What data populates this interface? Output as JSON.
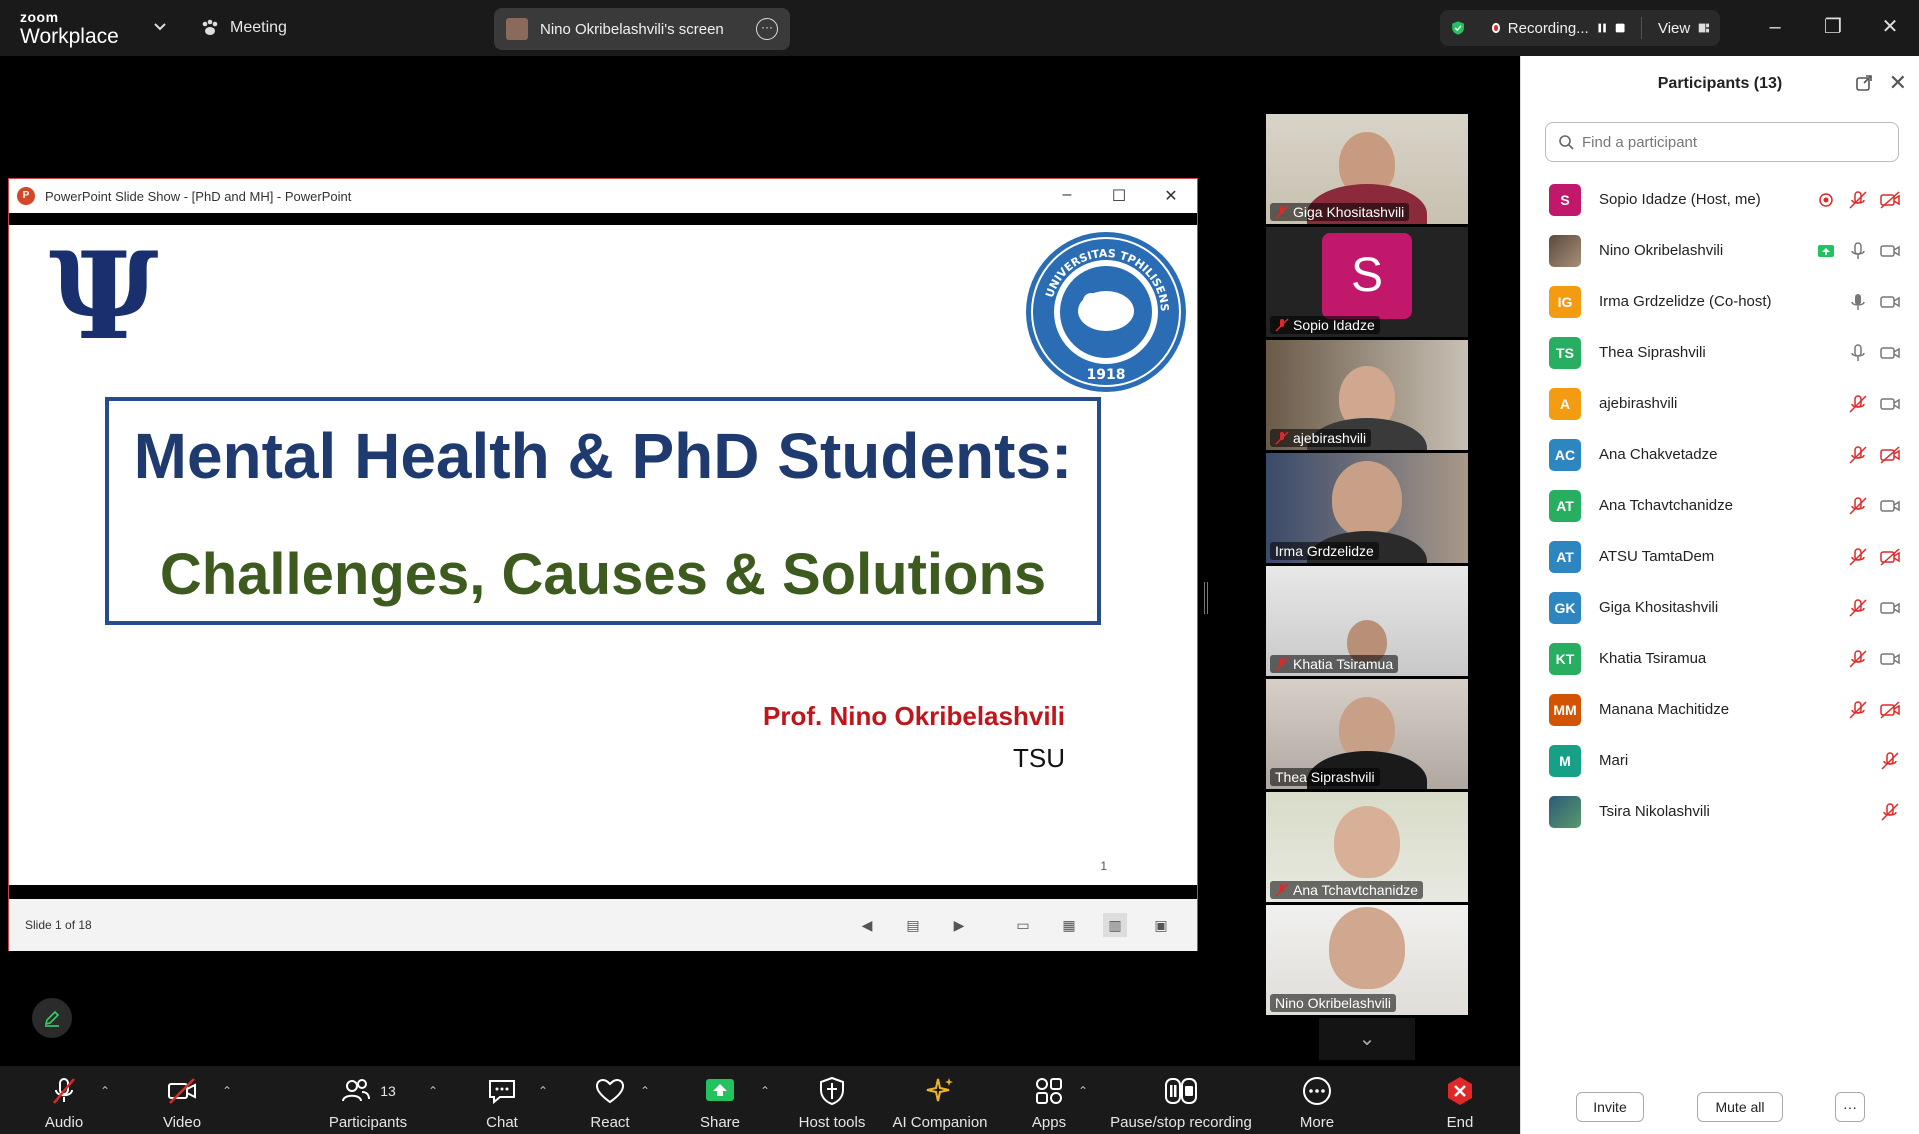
{
  "titlebar": {
    "logo_small": "zoom",
    "logo_big": "Workplace",
    "meeting_label": "Meeting",
    "screen_share_label": "Nino Okribelashvili's screen",
    "recording_label": "Recording...",
    "view_label": "View"
  },
  "ppt": {
    "window_title": "PowerPoint Slide Show - [PhD and MH] - PowerPoint",
    "icon_letter": "P",
    "slide_title_line1": "Mental Health & PhD Students:",
    "slide_title_line2": "Challenges, Causes & Solutions",
    "psi_symbol": "Ψ",
    "author": "Prof. Nino Okribelashvili",
    "institution": "TSU",
    "page_number": "1",
    "seal_year": "1918",
    "seal_text": "UNIVERSITAS TPHILISENSIS",
    "status": "Slide 1 of 18"
  },
  "video_tiles": [
    {
      "name": "Giga Khositashvili",
      "muted": true
    },
    {
      "name": "Sopio Idadze",
      "muted": true,
      "avatar": "S"
    },
    {
      "name": "ajebirashvili",
      "muted": true
    },
    {
      "name": "Irma Grdzelidze",
      "muted": false,
      "active": true
    },
    {
      "name": "Khatia Tsiramua",
      "muted": true
    },
    {
      "name": "Thea Siprashvili",
      "muted": false
    },
    {
      "name": "Ana Tchavtchanidze",
      "muted": true
    },
    {
      "name": "Nino Okribelashvili",
      "muted": false
    }
  ],
  "participants_panel": {
    "title": "Participants (13)",
    "search_placeholder": "Find a participant",
    "invite_label": "Invite",
    "mute_all_label": "Mute all",
    "more_label": "···",
    "participants": [
      {
        "initials": "S",
        "name": "Sopio Idadze (Host, me)",
        "color": "#c2186b"
      },
      {
        "initials": "",
        "name": "Nino Okribelashvili",
        "color": "#7a5c4a"
      },
      {
        "initials": "IG",
        "name": "Irma Grdzelidze (Co-host)",
        "color": "#f39c12"
      },
      {
        "initials": "TS",
        "name": "Thea Siprashvili",
        "color": "#27ae60"
      },
      {
        "initials": "A",
        "name": "ajebirashvili",
        "color": "#f39c12"
      },
      {
        "initials": "AC",
        "name": "Ana Chakvetadze",
        "color": "#2e86c1"
      },
      {
        "initials": "AT",
        "name": "Ana Tchavtchanidze",
        "color": "#27ae60"
      },
      {
        "initials": "AT",
        "name": "ATSU TamtaDem",
        "color": "#2e86c1"
      },
      {
        "initials": "GK",
        "name": "Giga Khositashvili",
        "color": "#2e86c1"
      },
      {
        "initials": "KT",
        "name": "Khatia Tsiramua",
        "color": "#27ae60"
      },
      {
        "initials": "MM",
        "name": "Manana Machitidze",
        "color": "#d35400"
      },
      {
        "initials": "M",
        "name": "Mari",
        "color": "#16a085"
      },
      {
        "initials": "",
        "name": "Tsira Nikolashvili",
        "color": "#3a6a5a"
      }
    ]
  },
  "toolbar": {
    "audio": "Audio",
    "video": "Video",
    "participants": "Participants",
    "participants_count": "13",
    "chat": "Chat",
    "react": "React",
    "share": "Share",
    "host_tools": "Host tools",
    "ai_companion": "AI Companion",
    "apps": "Apps",
    "pause_recording": "Pause/stop recording",
    "more": "More",
    "end": "End"
  },
  "colors": {
    "accent_green": "#2fd46a",
    "end_red": "#e02828",
    "share_green": "#22c35e"
  }
}
